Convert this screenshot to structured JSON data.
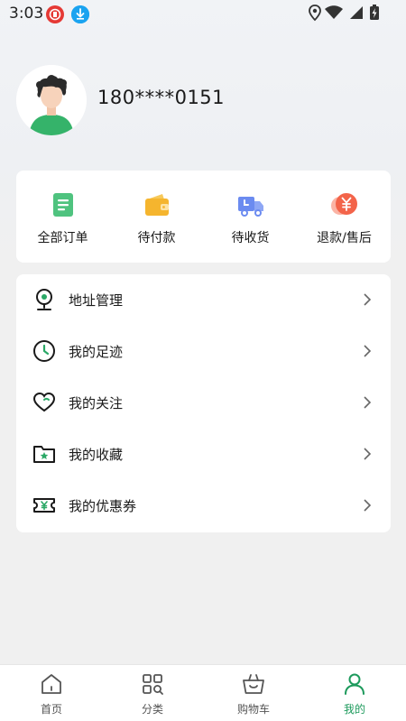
{
  "status_bar": {
    "time": "3:03"
  },
  "profile": {
    "phone": "180****0151"
  },
  "orders": {
    "items": [
      {
        "label": "全部订单",
        "icon": "list-icon",
        "color": "#4fc37f"
      },
      {
        "label": "待付款",
        "icon": "wallet-icon",
        "color": "#f5b52e"
      },
      {
        "label": "待收货",
        "icon": "truck-icon",
        "color": "#6b8bf0"
      },
      {
        "label": "退款/售后",
        "icon": "yuan-refund-icon",
        "color": "#f3644a"
      }
    ]
  },
  "menu": {
    "items": [
      {
        "label": "地址管理",
        "icon": "location-pin-icon"
      },
      {
        "label": "我的足迹",
        "icon": "clock-icon"
      },
      {
        "label": "我的关注",
        "icon": "heart-icon"
      },
      {
        "label": "我的收藏",
        "icon": "folder-star-icon"
      },
      {
        "label": "我的优惠券",
        "icon": "coupon-icon"
      }
    ]
  },
  "tabbar": {
    "items": [
      {
        "label": "首页",
        "icon": "home-icon",
        "active": false
      },
      {
        "label": "分类",
        "icon": "category-icon",
        "active": false
      },
      {
        "label": "购物车",
        "icon": "basket-icon",
        "active": false
      },
      {
        "label": "我的",
        "icon": "person-icon",
        "active": true
      }
    ],
    "active_color": "#1d9a5c",
    "inactive_color": "#555555"
  }
}
